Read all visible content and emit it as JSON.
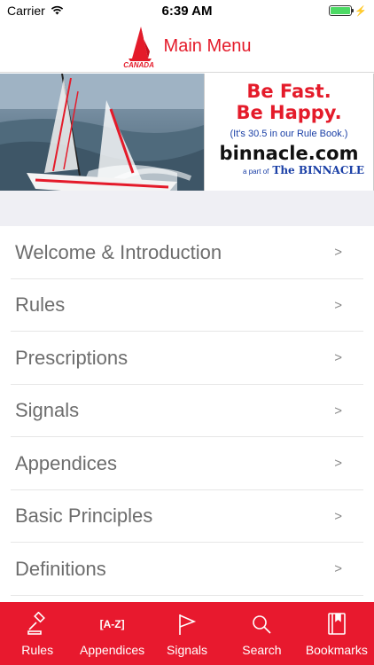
{
  "status_bar": {
    "carrier": "Carrier",
    "time": "6:39 AM",
    "battery_level": 1.0
  },
  "header": {
    "logo_text": "CANADA",
    "title": "Main Menu"
  },
  "banner": {
    "headline_1": "Be Fast.",
    "headline_2": "Be Happy.",
    "subline": "(It's 30.5 in our Rule Book.)",
    "domain": "binnacle.com",
    "tag_prefix": "a part of",
    "tag_brand": "The BINNACLE"
  },
  "menu": {
    "items": [
      {
        "label": "Welcome & Introduction",
        "chevron": ">"
      },
      {
        "label": "Rules",
        "chevron": ">"
      },
      {
        "label": "Prescriptions",
        "chevron": ">"
      },
      {
        "label": "Signals",
        "chevron": ">"
      },
      {
        "label": "Appendices",
        "chevron": ">"
      },
      {
        "label": "Basic Principles",
        "chevron": ">"
      },
      {
        "label": "Definitions",
        "chevron": ">"
      }
    ]
  },
  "tab_bar": {
    "accent_color": "#e8192e",
    "tabs": [
      {
        "label": "Rules",
        "icon": "gavel-icon"
      },
      {
        "label": "Appendices",
        "icon_text": "[A-Z]",
        "icon": "az-icon"
      },
      {
        "label": "Signals",
        "icon": "flag-icon"
      },
      {
        "label": "Search",
        "icon": "search-icon"
      },
      {
        "label": "Bookmarks",
        "icon": "book-icon"
      }
    ]
  }
}
